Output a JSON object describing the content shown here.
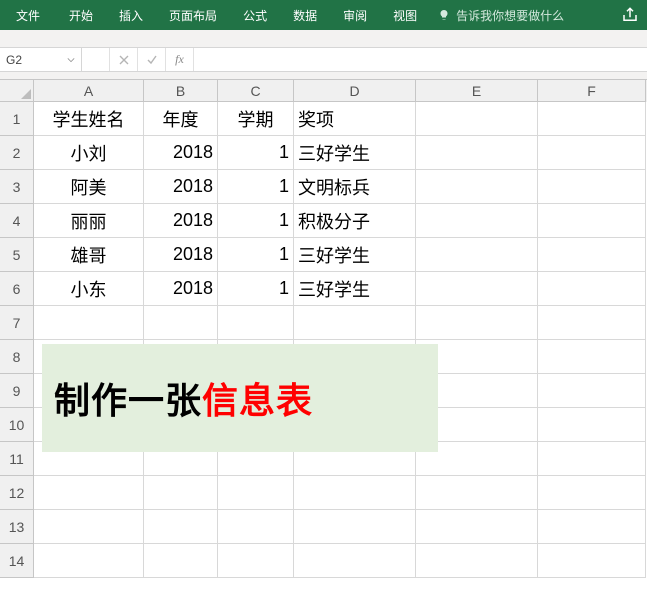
{
  "ribbon": {
    "tabs": [
      "文件",
      "开始",
      "插入",
      "页面布局",
      "公式",
      "数据",
      "审阅",
      "视图"
    ],
    "tell_me": "告诉我你想要做什么"
  },
  "nameBox": {
    "value": "G2"
  },
  "formulaBar": {
    "fx_label": "fx",
    "value": ""
  },
  "columns": [
    "A",
    "B",
    "C",
    "D",
    "E",
    "F"
  ],
  "rowNumbers": [
    "1",
    "2",
    "3",
    "4",
    "5",
    "6",
    "7",
    "8",
    "9",
    "10",
    "11",
    "12",
    "13",
    "14"
  ],
  "data": {
    "headers": {
      "a": "学生姓名",
      "b": "年度",
      "c": "学期",
      "d": "奖项"
    },
    "rows": [
      {
        "a": "小刘",
        "b": "2018",
        "c": "1",
        "d": "三好学生"
      },
      {
        "a": "阿美",
        "b": "2018",
        "c": "1",
        "d": "文明标兵"
      },
      {
        "a": "丽丽",
        "b": "2018",
        "c": "1",
        "d": "积极分子"
      },
      {
        "a": "雄哥",
        "b": "2018",
        "c": "1",
        "d": "三好学生"
      },
      {
        "a": "小东",
        "b": "2018",
        "c": "1",
        "d": "三好学生"
      }
    ]
  },
  "overlay": {
    "part1": "制作一张",
    "part2": "信息表"
  }
}
